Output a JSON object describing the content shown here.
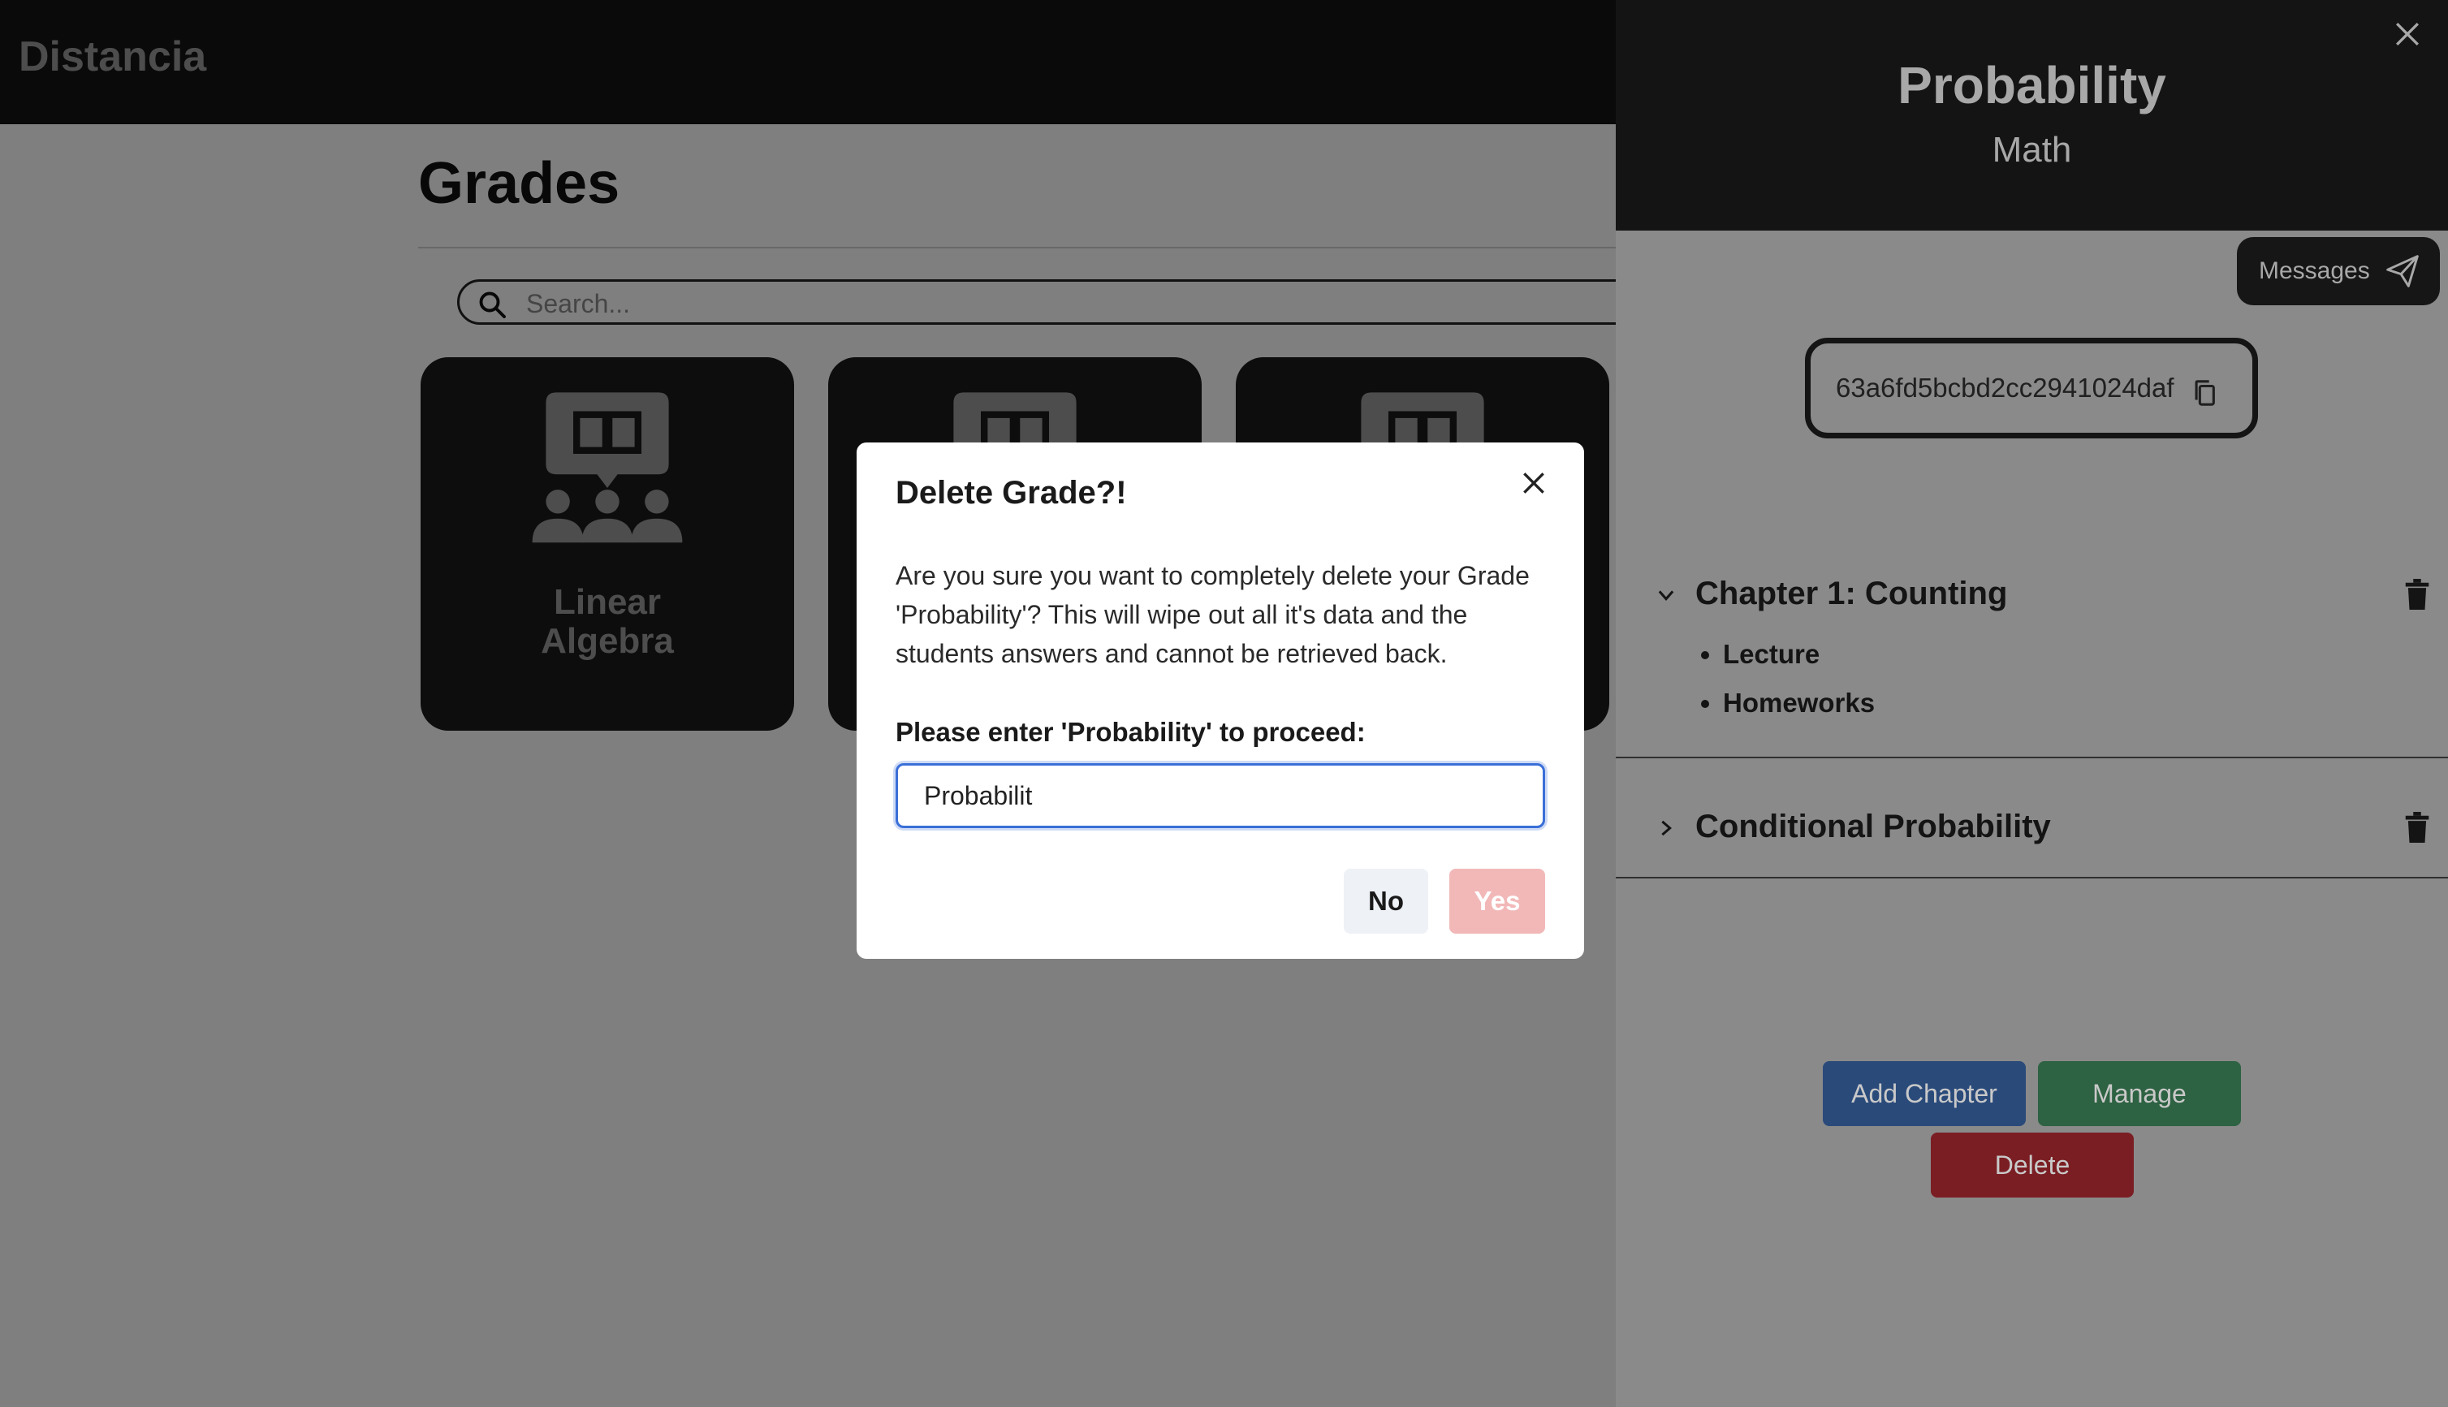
{
  "app": {
    "brand": "Distancia"
  },
  "page": {
    "title": "Grades",
    "search_placeholder": "Search..."
  },
  "cards": [
    {
      "label": "Linear\nAlgebra"
    },
    {
      "label": ""
    },
    {
      "label": ""
    }
  ],
  "drawer": {
    "title": "Probability",
    "subtitle": "Math",
    "messages_label": "Messages",
    "code": "63a6fd5bcbd2cc2941024daf",
    "chapters": [
      {
        "title": "Chapter 1: Counting",
        "expanded": true,
        "items": [
          "Lecture",
          "Homeworks"
        ]
      },
      {
        "title": "Conditional Probability",
        "expanded": false,
        "items": []
      }
    ],
    "buttons": {
      "add_chapter": "Add Chapter",
      "manage": "Manage",
      "delete": "Delete"
    }
  },
  "modal": {
    "title": "Delete Grade?!",
    "body": "Are you sure you want to completely delete your Grade 'Probability'? This will wipe out all it's data and the students answers and cannot be retrieved back.",
    "prompt": "Please enter 'Probability' to proceed:",
    "input_value": "Probabilit",
    "no_label": "No",
    "yes_label": "Yes"
  },
  "colors": {
    "topbar": "#141414",
    "drawer_bg": "#8a8a8a",
    "add_chapter": "#2a4a7a",
    "manage": "#2d6242",
    "delete": "#7a1e23",
    "yes_disabled": "#f2b8b8",
    "input_focus": "#3b6fd8"
  }
}
